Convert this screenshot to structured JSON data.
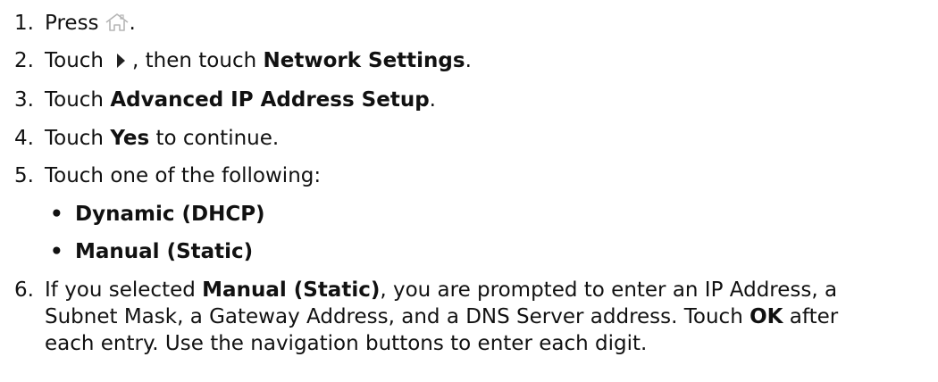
{
  "steps": [
    {
      "num": "1.",
      "pre": "Press",
      "icon": "home-icon",
      "post": "."
    },
    {
      "num": "2.",
      "pre": "Touch",
      "icon": "right-arrow-icon",
      "mid": ", then touch",
      "bold": "Network Settings",
      "post": "."
    },
    {
      "num": "3.",
      "pre": "Touch",
      "bold": "Advanced IP Address Setup",
      "post": "."
    },
    {
      "num": "4.",
      "pre": "Touch",
      "bold": "Yes",
      "post": "to continue."
    },
    {
      "num": "5.",
      "text": "Touch one of the following:"
    },
    {
      "num": "6.",
      "pre": "If you selected",
      "bold": "Manual (Static)",
      "post": ", you are prompted to enter an IP Address, a",
      "line2_pre": "Subnet Mask, a Gateway Address, and a DNS Server address. Touch",
      "line2_bold": "OK",
      "line2_post": "after",
      "line3": "each entry. Use the navigation buttons to enter each digit."
    }
  ],
  "options": [
    {
      "bullet": "•",
      "label": "Dynamic (DHCP)"
    },
    {
      "bullet": "•",
      "label": "Manual (Static)"
    }
  ],
  "colors": {
    "text": "#111111",
    "icon_gray": "#b5b5b5",
    "arrow": "#222222"
  }
}
